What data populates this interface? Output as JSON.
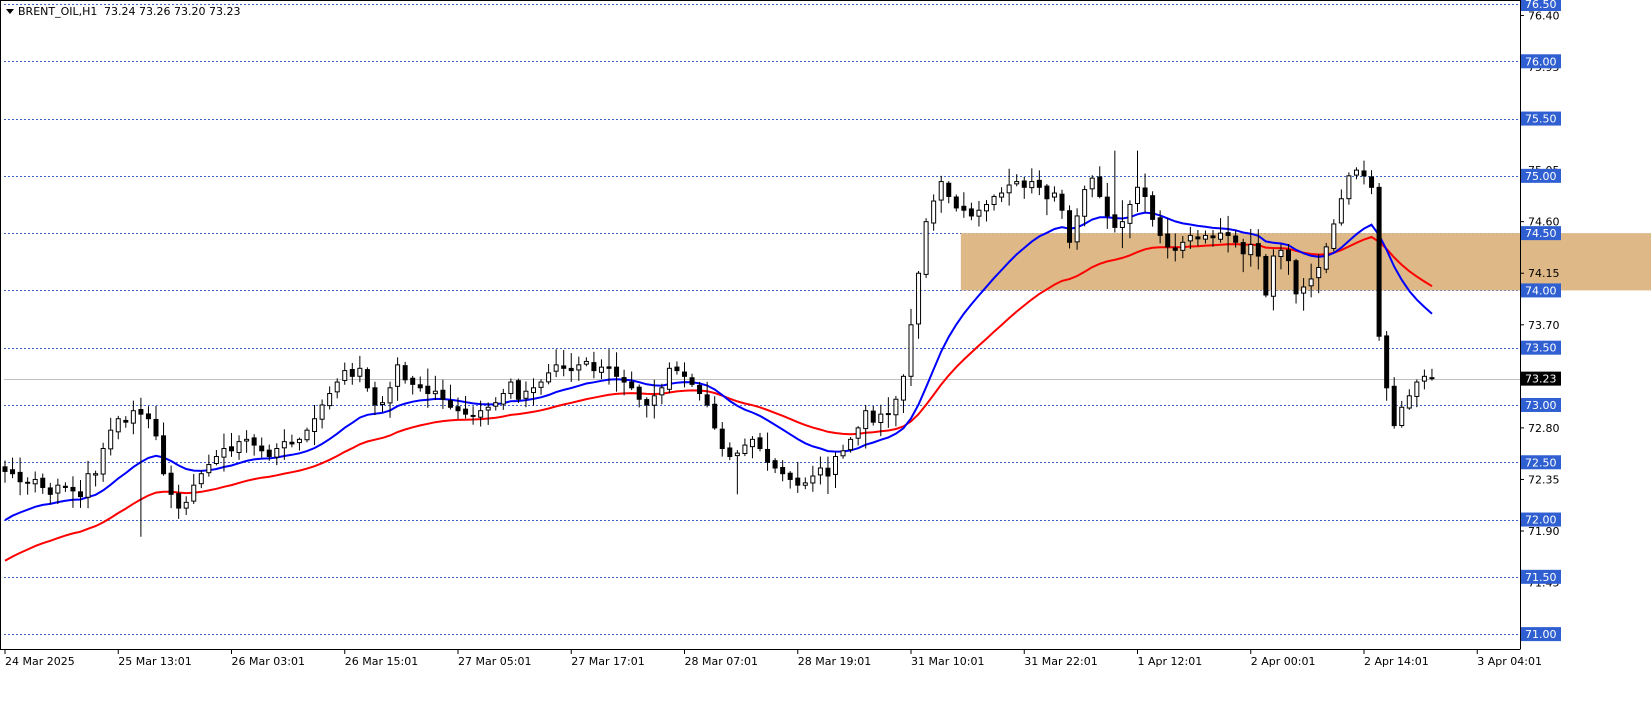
{
  "header": {
    "symbol": "BRENT_OIL,H1",
    "ohlc": "73.24 73.26 73.20 73.23",
    "menu_icon": "triangle-down-icon"
  },
  "colors": {
    "background": "#ffffff",
    "grid_line": "#3a62c8",
    "price_line": "#c0c0c0",
    "bull_body": "#ffffff",
    "bear_body": "#000000",
    "wick": "#000000",
    "ma_fast": "#0000ff",
    "ma_slow": "#ff0000",
    "zone_fill": "#deb887",
    "label_box": "#2f5fd0",
    "label_text": "#ffffff",
    "current_price_box": "#000000"
  },
  "chart_data": {
    "type": "candlestick",
    "timeframe": "H1",
    "ylim": [
      70.87,
      76.5
    ],
    "y_tick_labels": [
      "76.40",
      "75.95",
      "75.50",
      "75.05",
      "74.60",
      "74.15",
      "73.70",
      "73.25",
      "72.80",
      "72.35",
      "71.90",
      "71.45",
      "71.00"
    ],
    "y_tick_values": [
      76.4,
      75.95,
      75.5,
      75.05,
      74.6,
      74.15,
      73.7,
      73.25,
      72.8,
      72.35,
      71.9,
      71.45,
      71.0
    ],
    "level_lines": [
      76.5,
      76.0,
      75.5,
      75.0,
      74.5,
      74.0,
      73.5,
      73.0,
      72.5,
      72.0,
      71.5,
      71.0
    ],
    "level_labels": [
      "76.50",
      "76.00",
      "75.50",
      "75.00",
      "74.50",
      "74.00",
      "73.50",
      "73.00",
      "72.50",
      "72.00",
      "71.50",
      "71.00"
    ],
    "current_price": 73.23,
    "current_price_label": "73.23",
    "zone": {
      "from": 74.0,
      "to": 74.5,
      "start_bar": 127,
      "end_bar": 221
    },
    "x_labels": [
      {
        "text": "24 Mar 2025",
        "bar": 0
      },
      {
        "text": "25 Mar 13:01",
        "bar": 15
      },
      {
        "text": "26 Mar 03:01",
        "bar": 30
      },
      {
        "text": "26 Mar 15:01",
        "bar": 45
      },
      {
        "text": "27 Mar 05:01",
        "bar": 60
      },
      {
        "text": "27 Mar 17:01",
        "bar": 75
      },
      {
        "text": "28 Mar 07:01",
        "bar": 90
      },
      {
        "text": "28 Mar 19:01",
        "bar": 105
      },
      {
        "text": "31 Mar 10:01",
        "bar": 120
      },
      {
        "text": "31 Mar 22:01",
        "bar": 135
      },
      {
        "text": "1 Apr 12:01",
        "bar": 150
      },
      {
        "text": "2 Apr 00:01",
        "bar": 165
      },
      {
        "text": "2 Apr 14:01",
        "bar": 180
      },
      {
        "text": "3 Apr 04:01",
        "bar": 195
      }
    ],
    "close_path": [
      72.42,
      72.4,
      72.33,
      72.32,
      72.35,
      72.28,
      72.22,
      72.3,
      72.28,
      72.25,
      72.2,
      72.4,
      72.4,
      72.62,
      72.78,
      72.88,
      72.85,
      72.95,
      72.92,
      72.88,
      72.73,
      72.4,
      72.22,
      72.1,
      72.15,
      72.3,
      72.4,
      72.48,
      72.55,
      72.62,
      72.6,
      72.68,
      72.7,
      72.65,
      72.6,
      72.55,
      72.62,
      72.68,
      72.66,
      72.7,
      72.78,
      72.88,
      73.0,
      73.1,
      73.2,
      73.3,
      73.25,
      73.32,
      73.15,
      73.0,
      73.02,
      73.15,
      73.35,
      73.22,
      73.18,
      73.15,
      73.1,
      73.12,
      73.05,
      72.98,
      72.95,
      72.92,
      72.9,
      72.95,
      72.98,
      73.02,
      73.1,
      73.2,
      73.05,
      73.12,
      73.15,
      73.2,
      73.28,
      73.35,
      73.32,
      73.3,
      73.35,
      73.38,
      73.3,
      73.33,
      73.32,
      73.25,
      73.2,
      73.15,
      73.05,
      73.0,
      73.08,
      73.15,
      73.32,
      73.3,
      73.25,
      73.18,
      73.1,
      73.0,
      72.8,
      72.62,
      72.55,
      72.58,
      72.65,
      72.7,
      72.62,
      72.5,
      72.45,
      72.4,
      72.35,
      72.3,
      72.32,
      72.38,
      72.45,
      72.38,
      72.55,
      72.6,
      72.7,
      72.8,
      72.95,
      72.85,
      72.92,
      72.92,
      73.05,
      73.25,
      73.7,
      74.15,
      74.6,
      74.78,
      74.95,
      74.82,
      74.72,
      74.7,
      74.65,
      74.7,
      74.75,
      74.82,
      74.85,
      74.92,
      74.95,
      74.9,
      74.95,
      74.9,
      74.8,
      74.85,
      74.7,
      74.42,
      74.65,
      74.88,
      74.98,
      74.82,
      74.65,
      74.55,
      74.6,
      74.75,
      74.9,
      74.82,
      74.62,
      74.48,
      74.38,
      74.35,
      74.42,
      74.48,
      74.45,
      74.48,
      74.46,
      74.5,
      74.48,
      74.42,
      74.32,
      74.4,
      74.3,
      73.96,
      74.3,
      74.35,
      74.26,
      73.97,
      74.03,
      74.1,
      74.2,
      74.38,
      74.58,
      74.8,
      75.0,
      75.05,
      75.0,
      74.9,
      73.6,
      73.15,
      72.82,
      72.98,
      73.08,
      73.2,
      73.25,
      73.23
    ],
    "ma_fast_last": 74.18,
    "ma_slow_last": 73.88
  }
}
